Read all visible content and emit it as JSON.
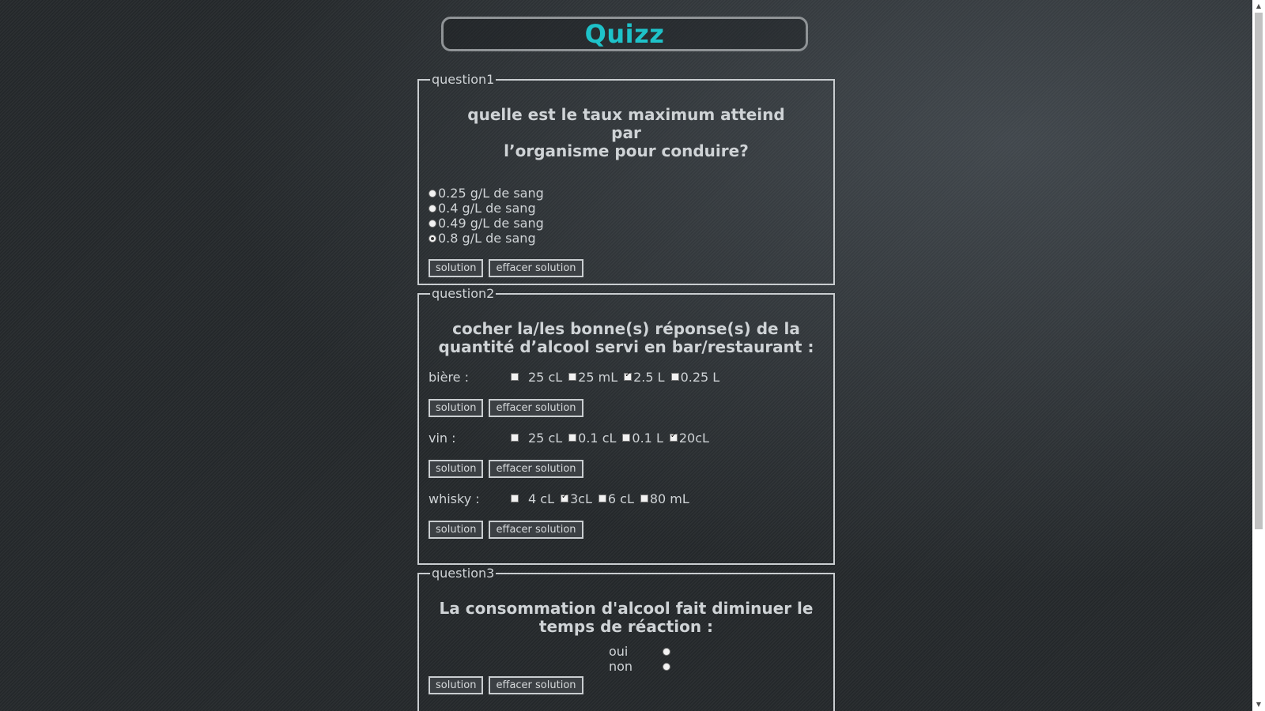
{
  "page": {
    "title": "Quizz"
  },
  "q1": {
    "legend": "question1",
    "text_line1": "quelle est le taux maximum atteind par",
    "text_line2": "l’organisme pour conduire?",
    "options": [
      "0.25 g/L de sang",
      "0.4 g/L de sang",
      "0.49 g/L de sang",
      "0.8 g/L de sang"
    ],
    "selected_index": 3,
    "solution_label": "solution",
    "clear_label": "effacer solution"
  },
  "q2": {
    "legend": "question2",
    "text_line1": "cocher la/les bonne(s) réponse(s) de la",
    "text_line2": "quantité d’alcool servi en bar/restaurant :",
    "rows": [
      {
        "label": "bière :",
        "options": [
          {
            "text": "25 cL",
            "checked": false
          },
          {
            "text": "25 mL",
            "checked": false
          },
          {
            "text": "2.5 L",
            "checked": true
          },
          {
            "text": "0.25 L",
            "checked": false
          }
        ]
      },
      {
        "label": "vin :",
        "options": [
          {
            "text": "25 cL",
            "checked": false
          },
          {
            "text": "0.1 cL",
            "checked": false
          },
          {
            "text": "0.1 L",
            "checked": false
          },
          {
            "text": "20cL",
            "checked": true
          }
        ]
      },
      {
        "label": "whisky :",
        "options": [
          {
            "text": "4 cL",
            "checked": false
          },
          {
            "text": "3cL",
            "checked": true
          },
          {
            "text": "6 cL",
            "checked": false
          },
          {
            "text": "80 mL",
            "checked": false
          }
        ]
      }
    ],
    "solution_label": "solution",
    "clear_label": "effacer solution"
  },
  "q3": {
    "legend": "question3",
    "text_line1": "La consommation d'alcool fait diminuer le",
    "text_line2": "temps de réaction :",
    "options": [
      "oui",
      "non"
    ],
    "solution_label": "solution",
    "clear_label": "effacer solution"
  },
  "colors": {
    "title": "#1ec2c9",
    "text": "#cfd3d6",
    "background": "#25292c"
  }
}
